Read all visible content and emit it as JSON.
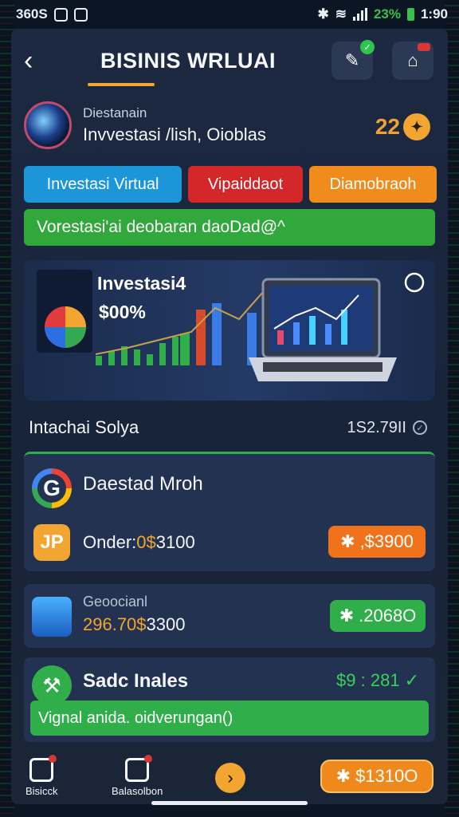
{
  "status_bar": {
    "left_text": "360S",
    "battery": "23%",
    "time": "1:90"
  },
  "header": {
    "title": "BISINIS WRLUAI"
  },
  "profile": {
    "subtitle": "Diestanain",
    "name": "Invvestasi /lish, Oioblas",
    "count": "22"
  },
  "tabs": [
    {
      "label": "Investasi Virtual",
      "color": "#1d95d9"
    },
    {
      "label": "Vipaiddaot",
      "color": "#d4272a"
    },
    {
      "label": "Diamobraoh",
      "color": "#f08c1c"
    }
  ],
  "banner": {
    "text": "Vorestasi'ai deobaran daoDad@^"
  },
  "hero": {
    "label": "Investasi4",
    "value": "$00%"
  },
  "section": {
    "title": "Intachai Solya",
    "value": "1S2.79II"
  },
  "cards": {
    "card1": {
      "title": "Daestad Mroh",
      "icon_text": "JP",
      "line_prefix": "Onder:",
      "line_highlight": "0$",
      "line_suffix": "3100",
      "pill": ",$3900"
    },
    "card2": {
      "subtitle": "Geoocianl",
      "line_prefix": "296.70",
      "line_highlight": "$",
      "line_suffix": "3300",
      "pill": ".2068O"
    },
    "card3": {
      "title": "Sadc Inales",
      "value": "$9 : 281",
      "bar_text": "Vignal anida. oidverungan()"
    }
  },
  "bottom_nav": {
    "item1": "Bisicck",
    "item2": "Balasolbon",
    "pill": "$1310O"
  },
  "colors": {
    "accent_orange": "#f2a531",
    "accent_green": "#2fae4a",
    "accent_red": "#d4272a",
    "accent_blue": "#1d95d9"
  }
}
